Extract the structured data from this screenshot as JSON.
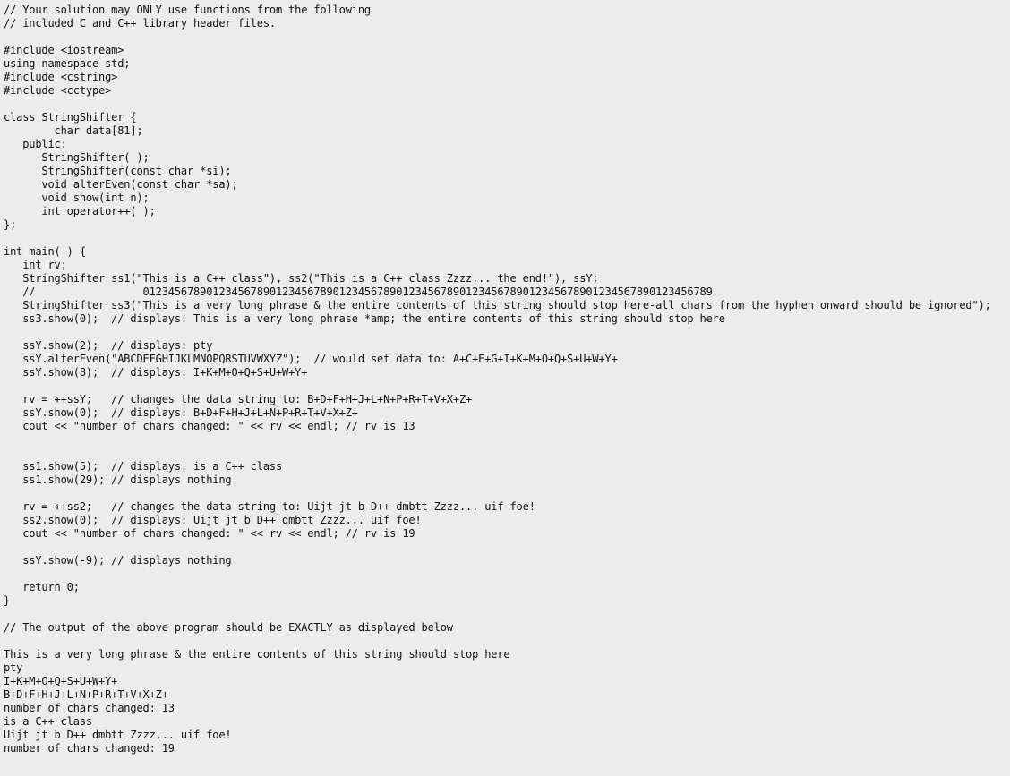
{
  "page": {
    "background_color": "#ececec",
    "text_color": "#111111",
    "kind": "source-code-listing",
    "language": "C++"
  },
  "code": {
    "lines": [
      "// Your solution may ONLY use functions from the following",
      "// included C and C++ library header files.",
      "",
      "#include <iostream>",
      "using namespace std;",
      "#include <cstring>",
      "#include <cctype>",
      "",
      "class StringShifter {",
      "        char data[81];",
      "   public:",
      "      StringShifter( );",
      "      StringShifter(const char *si);",
      "      void alterEven(const char *sa);",
      "      void show(int n);",
      "      int operator++( );",
      "};",
      "",
      "int main( ) {",
      "   int rv;",
      "   StringShifter ss1(\"This is a C++ class\"), ss2(\"This is a C++ class Zzzz... the end!\"), ssY;",
      "   //                 012345678901234567890123456789012345678901234567890123456789012345678901234567890123456789",
      "   StringShifter ss3(\"This is a very long phrase & the entire contents of this string should stop here-all chars from the hyphen onward should be ignored\");",
      "   ss3.show(0);  // displays: This is a very long phrase *amp; the entire contents of this string should stop here",
      "",
      "   ssY.show(2);  // displays: pty",
      "   ssY.alterEven(\"ABCDEFGHIJKLMNOPQRSTUVWXYZ\");  // would set data to: A+C+E+G+I+K+M+O+Q+S+U+W+Y+",
      "   ssY.show(8);  // displays: I+K+M+O+Q+S+U+W+Y+",
      "",
      "   rv = ++ssY;   // changes the data string to: B+D+F+H+J+L+N+P+R+T+V+X+Z+",
      "   ssY.show(0);  // displays: B+D+F+H+J+L+N+P+R+T+V+X+Z+",
      "   cout << \"number of chars changed: \" << rv << endl; // rv is 13",
      "",
      "",
      "   ss1.show(5);  // displays: is a C++ class",
      "   ss1.show(29); // displays nothing",
      "",
      "   rv = ++ss2;   // changes the data string to: Uijt jt b D++ dmbtt Zzzz... uif foe!",
      "   ss2.show(0);  // displays: Uijt jt b D++ dmbtt Zzzz... uif foe!",
      "   cout << \"number of chars changed: \" << rv << endl; // rv is 19",
      "",
      "   ssY.show(-9); // displays nothing",
      "",
      "   return 0;",
      "}",
      "",
      "// The output of the above program should be EXACTLY as displayed below",
      "",
      "This is a very long phrase & the entire contents of this string should stop here",
      "pty",
      "I+K+M+O+Q+S+U+W+Y+",
      "B+D+F+H+J+L+N+P+R+T+V+X+Z+",
      "number of chars changed: 13",
      "is a C++ class",
      "Uijt jt b D++ dmbtt Zzzz... uif foe!",
      "number of chars changed: 19"
    ]
  }
}
